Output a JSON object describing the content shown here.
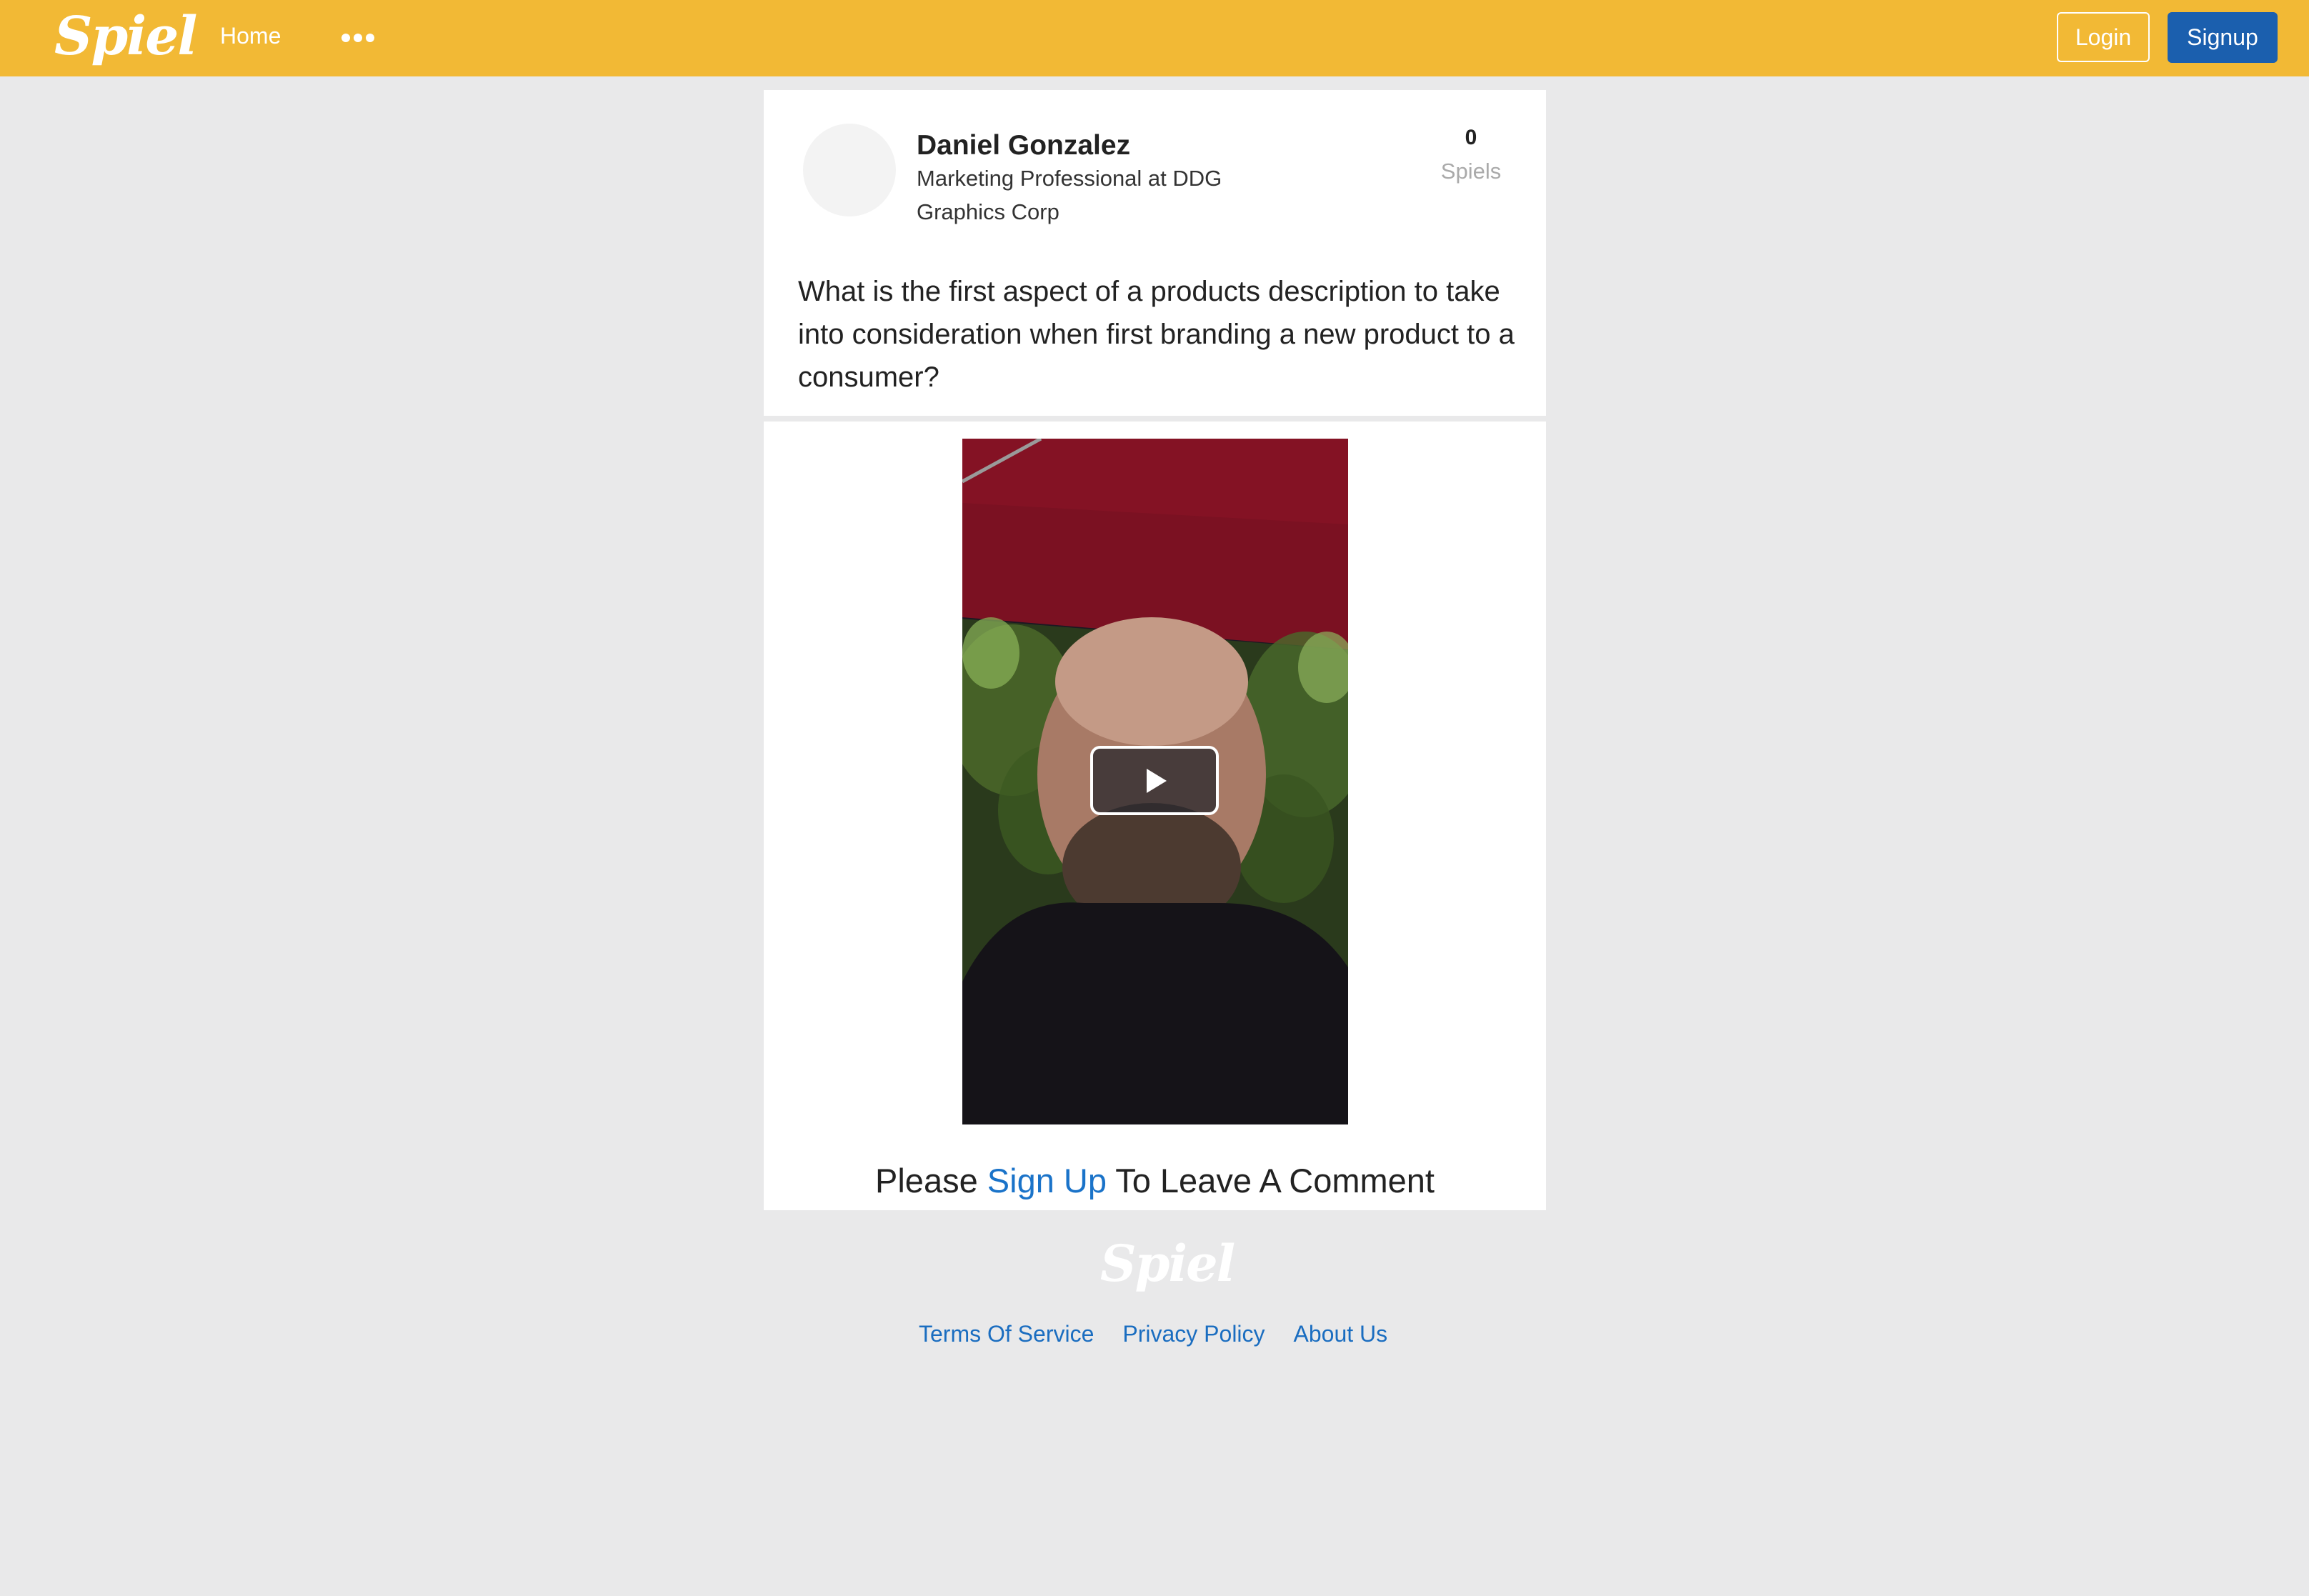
{
  "header": {
    "logo": "Spiel",
    "nav_home": "Home",
    "more_icon": "more-dots-icon",
    "login_label": "Login",
    "signup_label": "Signup",
    "bar_color": "#f2b935",
    "signup_color": "#1b5fae"
  },
  "post": {
    "author_name": "Daniel Gonzalez",
    "author_title": "Marketing Professional at DDG Graphics Corp",
    "spiels_count": "0",
    "spiels_label": "Spiels",
    "question": "What is the first aspect of a products description to take into consideration when first branding a new product to a consumer?",
    "video_play_icon": "play-icon"
  },
  "comment": {
    "prefix": "Please ",
    "signup_link": "Sign Up",
    "suffix": " To Leave A Comment"
  },
  "footer": {
    "logo": "Spiel",
    "links": [
      "Terms Of Service",
      "Privacy Policy",
      "About Us"
    ],
    "link_color": "#1a6dc0"
  }
}
